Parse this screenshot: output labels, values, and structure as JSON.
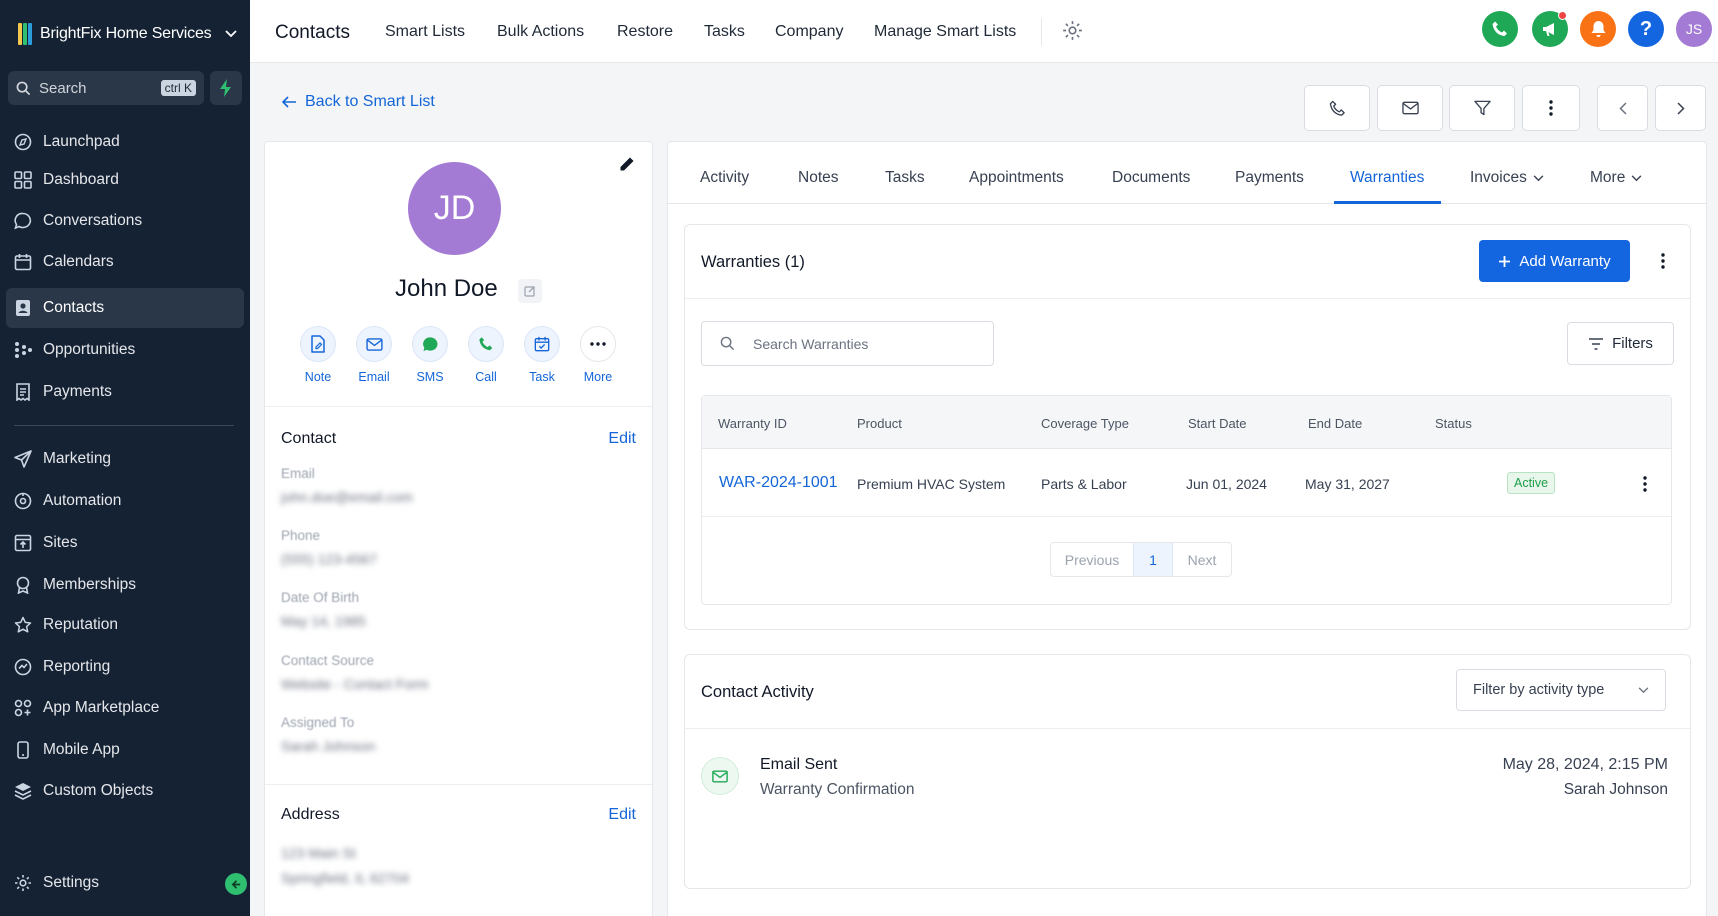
{
  "sidebar": {
    "brand": "BrightFix Home Services",
    "search_label": "Search",
    "search_shortcut": "ctrl K",
    "items": [
      {
        "label": "Launchpad",
        "icon": "launchpad-icon"
      },
      {
        "label": "Dashboard",
        "icon": "grid-icon"
      },
      {
        "label": "Conversations",
        "icon": "chat-icon"
      },
      {
        "label": "Calendars",
        "icon": "calendar-icon"
      },
      {
        "label": "Contacts",
        "icon": "contacts-icon",
        "active": true
      },
      {
        "label": "Opportunities",
        "icon": "opportunities-icon"
      },
      {
        "label": "Payments",
        "icon": "receipt-icon"
      },
      {
        "label": "Marketing",
        "icon": "send-icon"
      },
      {
        "label": "Automation",
        "icon": "automation-icon"
      },
      {
        "label": "Sites",
        "icon": "sites-icon"
      },
      {
        "label": "Memberships",
        "icon": "badge-icon"
      },
      {
        "label": "Reputation",
        "icon": "star-icon"
      },
      {
        "label": "Reporting",
        "icon": "reporting-icon"
      },
      {
        "label": "App Marketplace",
        "icon": "apps-icon"
      },
      {
        "label": "Mobile App",
        "icon": "mobile-icon"
      },
      {
        "label": "Custom Objects",
        "icon": "layers-icon"
      }
    ],
    "settings_label": "Settings"
  },
  "topbar": {
    "title": "Contacts",
    "links": [
      "Smart Lists",
      "Bulk Actions",
      "Restore",
      "Tasks",
      "Company",
      "Manage Smart Lists"
    ],
    "avatar_initials": "JS",
    "help_label": "?"
  },
  "back_link": "Back to Smart List",
  "contact": {
    "initials": "JD",
    "name": "John Doe",
    "actions": [
      "Note",
      "Email",
      "SMS",
      "Call",
      "Task",
      "More"
    ],
    "contact_section": "Contact",
    "edit_label": "Edit",
    "fields": [
      {
        "label": "Email",
        "value": "john.doe@email.com"
      },
      {
        "label": "Phone",
        "value": "(555) 123-4567"
      },
      {
        "label": "Date Of Birth",
        "value": "May 14, 1985"
      },
      {
        "label": "Contact Source",
        "value": "Website - Contact Form"
      },
      {
        "label": "Assigned To",
        "value": "Sarah Johnson"
      }
    ],
    "address_section": "Address",
    "address_lines": [
      "123 Main St",
      "Springfield, IL 62704"
    ]
  },
  "tabs": [
    "Activity",
    "Notes",
    "Tasks",
    "Appointments",
    "Documents",
    "Payments",
    "Warranties",
    "Invoices",
    "More"
  ],
  "active_tab": "Warranties",
  "warranties": {
    "title": "Warranties (1)",
    "add_label": "Add Warranty",
    "search_placeholder": "Search Warranties",
    "filters_label": "Filters",
    "columns": [
      "Warranty ID",
      "Product",
      "Coverage Type",
      "Start Date",
      "End Date",
      "Status"
    ],
    "rows": [
      {
        "id": "WAR-2024-1001",
        "product": "Premium HVAC System",
        "coverage": "Parts & Labor",
        "start": "Jun 01, 2024",
        "end": "May 31, 2027",
        "status": "Active"
      }
    ],
    "pager": {
      "previous": "Previous",
      "current": "1",
      "next": "Next"
    }
  },
  "activity": {
    "title": "Contact Activity",
    "filter_label": "Filter by activity type",
    "items": [
      {
        "title": "Email Sent",
        "subtitle": "Warranty Confirmation",
        "timestamp": "May 28, 2024, 2:15 PM",
        "user": "Sarah Johnson"
      }
    ]
  },
  "colors": {
    "sidebar_bg": "#152234",
    "accent": "#1466e0",
    "status_active": "#1e9e4a",
    "avatar": "#a37ad4"
  }
}
